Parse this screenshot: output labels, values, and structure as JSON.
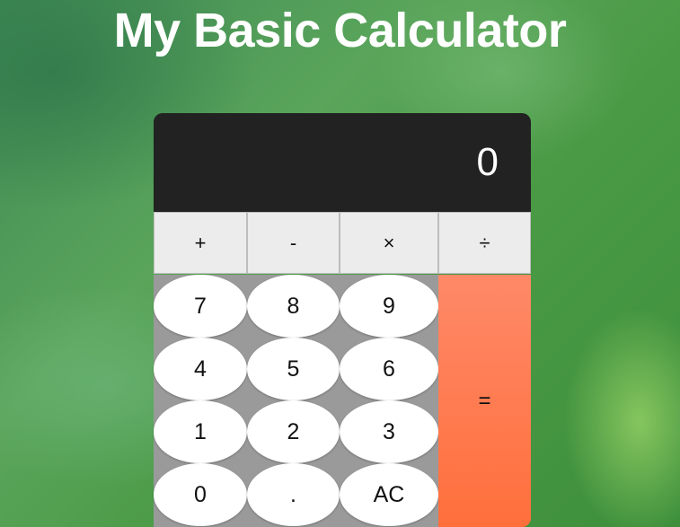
{
  "page": {
    "title": "My Basic Calculator"
  },
  "calculator": {
    "display_value": "0",
    "operators": [
      "+",
      "-",
      "×",
      "÷"
    ],
    "keys": {
      "k7": "7",
      "k8": "8",
      "k9": "9",
      "k4": "4",
      "k5": "5",
      "k6": "6",
      "k1": "1",
      "k2": "2",
      "k3": "3",
      "k0": "0",
      "kdot": ".",
      "kac": "AC"
    },
    "equals_label": "=",
    "colors": {
      "display_bg": "#222222",
      "operator_bg": "#ececec",
      "keypad_bg": "#9a9a9a",
      "equals_top": "#ff8968",
      "equals_bottom": "#ff6f3c"
    }
  }
}
